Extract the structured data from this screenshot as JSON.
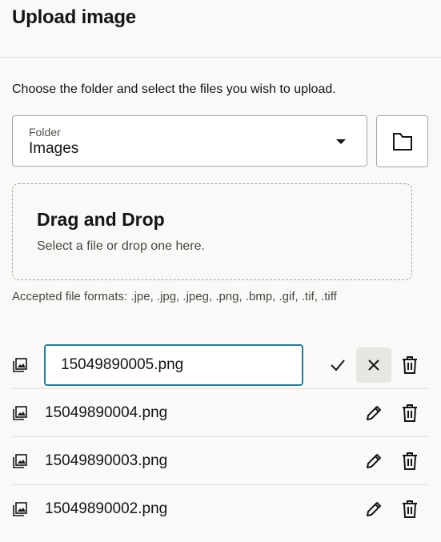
{
  "header": {
    "title": "Upload image"
  },
  "instructions": "Choose the folder and select the files you wish to upload.",
  "folder": {
    "label": "Folder",
    "value": "Images"
  },
  "dropzone": {
    "title": "Drag and Drop",
    "subtitle": "Select a file or drop one here."
  },
  "accepted_formats": "Accepted file formats: .jpe, .jpg, .jpeg, .png, .bmp, .gif, .tif, .tiff",
  "files": [
    {
      "name": "15049890005.png",
      "editing": true
    },
    {
      "name": "15049890004.png",
      "editing": false
    },
    {
      "name": "15049890003.png",
      "editing": false
    },
    {
      "name": "15049890002.png",
      "editing": false
    }
  ],
  "icons": {
    "file": "image-file-icon",
    "folder": "folder-icon",
    "confirm": "checkmark-icon",
    "cancel": "close-icon",
    "edit": "pencil-icon",
    "delete": "trash-icon",
    "dropdown": "caret-down-icon"
  },
  "colors": {
    "background": "#faf9f7",
    "input_focus_border": "#227e9e",
    "pressed_button": "#e8e6e3"
  }
}
